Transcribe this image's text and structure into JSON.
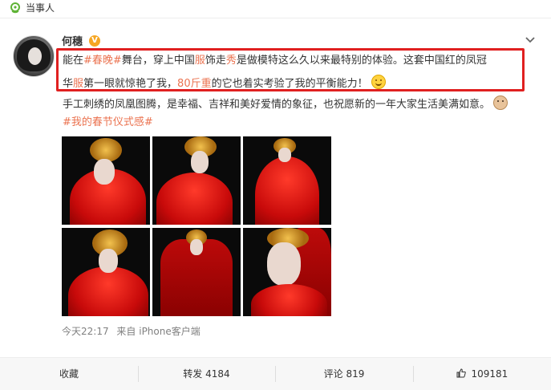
{
  "topbar": {
    "label": "当事人",
    "icon": "location-pin-icon"
  },
  "post": {
    "username": "何穗",
    "verified_badge": "V",
    "text_line1": {
      "p1": "能在",
      "tag": "#春晚#",
      "p2": "舞台，穿上中国",
      "hl1": "服",
      "p3": "饰走",
      "hl2": "秀",
      "p4": "是做模特这么久以来最特别的体验。这套中国红的凤冠"
    },
    "text_line2": {
      "p1": "华",
      "hl1": "服",
      "p2": "第一眼就惊艳了我，",
      "hl2": "80斤重",
      "p3": "的它也着实考验了我的平衡能力！"
    },
    "text_line3": "手工刺绣的凤凰图腾，是幸福、吉祥和美好爱情的象征，也祝愿新的一年大家生活美满如意。",
    "hashtag_link": "#我的春节仪式感#",
    "time": "今天22:17",
    "source": "来自 iPhone客户端"
  },
  "actions": {
    "favorite": "收藏",
    "repost_label": "转发",
    "repost_count": "4184",
    "comment_label": "评论",
    "comment_count": "819",
    "like_count": "109181"
  },
  "colors": {
    "accent": "#eb7350",
    "highlight_border": "#e02020"
  }
}
